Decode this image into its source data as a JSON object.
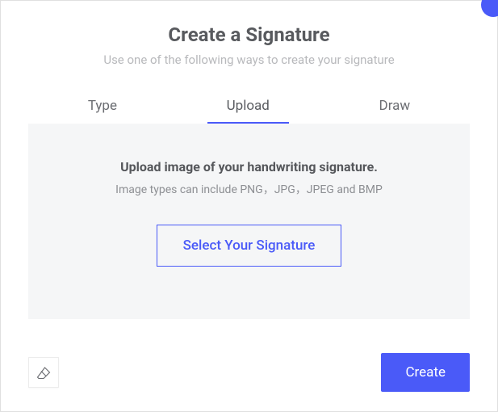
{
  "header": {
    "title": "Create a Signature",
    "subtitle": "Use one of the following ways to create your signature"
  },
  "tabs": {
    "type": "Type",
    "upload": "Upload",
    "draw": "Draw"
  },
  "content": {
    "instruction": "Upload image of your handwriting signature.",
    "hint": "Image types can include PNG，JPG，JPEG and BMP",
    "select_label": "Select Your Signature"
  },
  "footer": {
    "create_label": "Create"
  }
}
